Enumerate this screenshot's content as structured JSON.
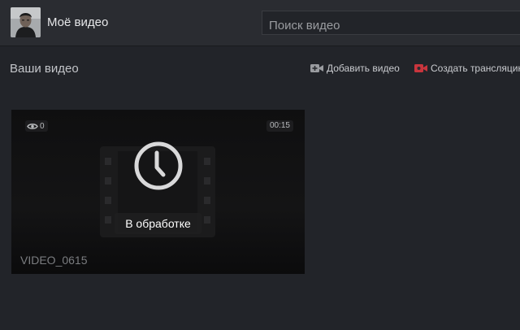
{
  "header": {
    "title": "Моё видео",
    "search_placeholder": "Поиск видео"
  },
  "section": {
    "title": "Ваши видео",
    "actions": {
      "add_video": "Добавить видео",
      "create_stream": "Создать трансляцию"
    }
  },
  "video": {
    "views": "0",
    "duration": "00:15",
    "status": "В обработке",
    "name": "VIDEO_0615"
  },
  "icons": {
    "avatar": "user-avatar",
    "add_video": "video-camera-plus-icon",
    "create_stream": "broadcast-camera-icon",
    "views": "eye-icon",
    "status": "clock-icon",
    "placeholder": "film-strip-icon"
  },
  "colors": {
    "background": "#222429",
    "topbar": "#2a2c31",
    "stream_icon": "#c9353d"
  }
}
